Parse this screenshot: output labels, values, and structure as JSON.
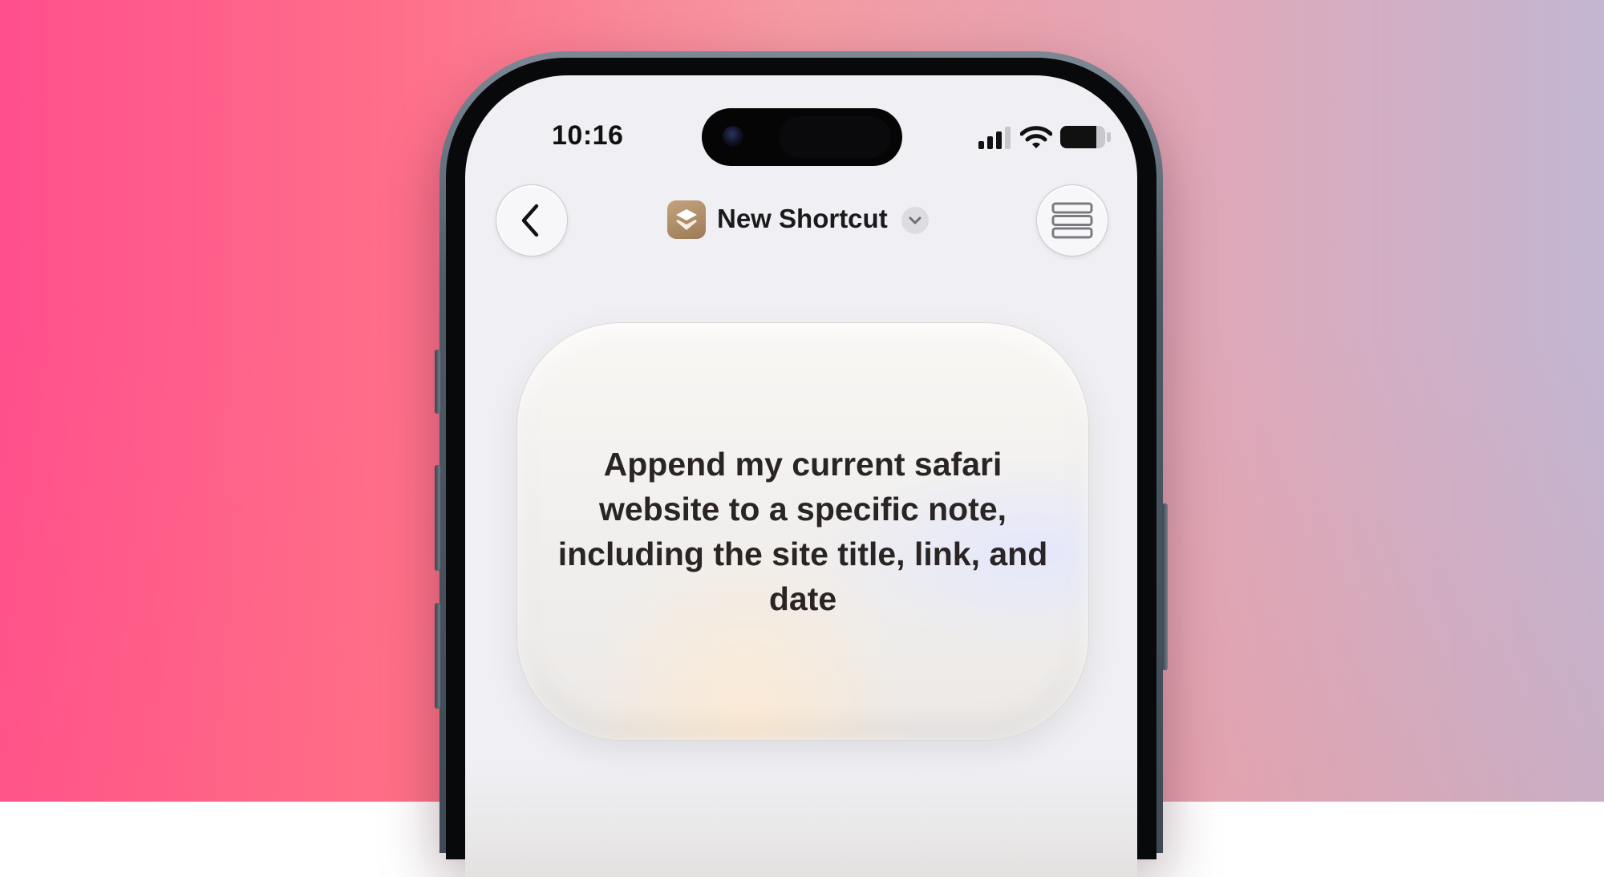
{
  "status_bar": {
    "time": "10:16",
    "icons": [
      "cellular-signal-icon",
      "wifi-icon",
      "battery-icon"
    ]
  },
  "nav_bar": {
    "back_icon": "chevron-left-icon",
    "title": "New Shortcut",
    "title_icon": "shortcuts-app-icon",
    "title_menu_icon": "chevron-down-icon",
    "menu_icon": "stacked-list-icon"
  },
  "prompt_card": {
    "text": "Append my current safari website to a specific note, including the site title, link, and date"
  },
  "colors": {
    "background_left": "#ff4f8d",
    "background_right": "#c2b6d2",
    "screen": "#f0eff4",
    "app_icon": "#b08e66"
  }
}
